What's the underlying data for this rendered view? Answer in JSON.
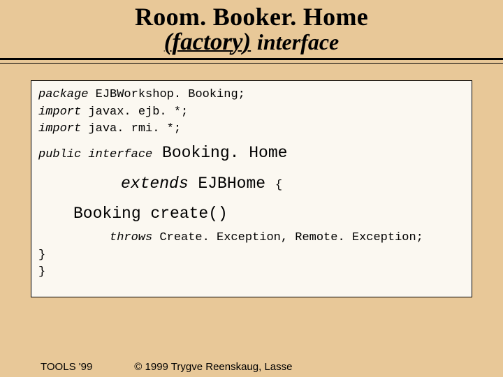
{
  "title": {
    "line1": "Room. Booker. Home",
    "factory": "(factory)",
    "interface": "interface"
  },
  "code": {
    "l1_kw": "package",
    "l1_rest": " EJBWorkshop. Booking;",
    "l2_kw": "import",
    "l2_rest": " javax. ejb. *;",
    "l3_kw": "import",
    "l3_rest": " java. rmi. *;",
    "l4_kw": "public interface",
    "l4_big": " Booking. Home",
    "l5_kwbig": "extends",
    "l5_big": " EJBHome ",
    "l5_brace": "{",
    "l6_big": "Booking create()",
    "l7_kw": "throws",
    "l7_rest": "  Create. Exception, Remote. Exception;",
    "l8": "}",
    "l9": "}"
  },
  "footer": {
    "left": "TOOLS '99",
    "right": "© 1999 Trygve Reenskaug, Lasse"
  }
}
